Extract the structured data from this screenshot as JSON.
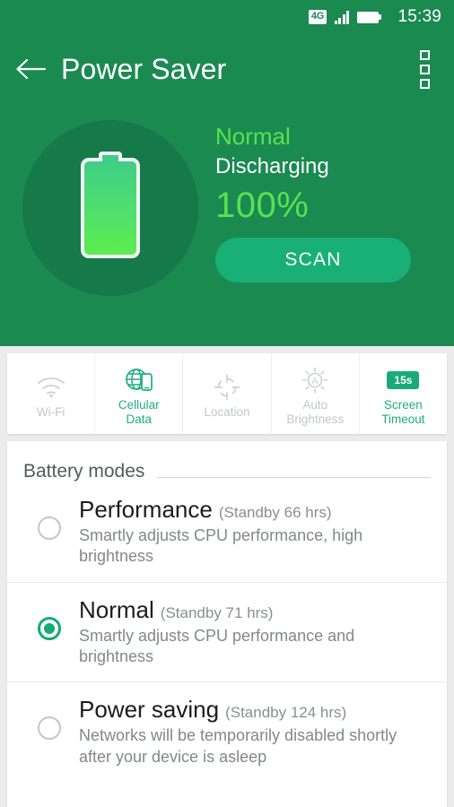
{
  "statusbar": {
    "network_badge": "4G",
    "time": "15:39",
    "signal_icon": "signal-bars-icon",
    "battery_icon": "battery-full-icon"
  },
  "appbar": {
    "title": "Power Saver",
    "back_icon": "back-arrow-icon",
    "overflow_icon": "overflow-menu-icon"
  },
  "hero": {
    "battery_icon": "battery-illustration-icon",
    "status": "Normal",
    "charging_state": "Discharging",
    "percent": "100%",
    "scan_label": "SCAN",
    "colors": {
      "header_bg": "#1a8a51",
      "circle_bg": "#16794a",
      "accent_green": "#57e251",
      "scan_bg": "#18b076"
    }
  },
  "toggles": [
    {
      "label": "Wi-Fi",
      "icon": "wifi-icon",
      "active": false,
      "badge": ""
    },
    {
      "label": "Cellular\nData",
      "label_line1": "Cellular",
      "label_line2": "Data",
      "icon": "cellular-data-icon",
      "active": true,
      "badge": ""
    },
    {
      "label": "Location",
      "icon": "location-crosshair-icon",
      "active": false,
      "badge": ""
    },
    {
      "label": "Auto\nBrightness",
      "label_line1": "Auto",
      "label_line2": "Brightness",
      "icon": "auto-brightness-icon",
      "active": false,
      "badge": ""
    },
    {
      "label": "Screen\nTimeout",
      "label_line1": "Screen",
      "label_line2": "Timeout",
      "icon": "screen-timeout-badge",
      "active": true,
      "badge": "15s"
    }
  ],
  "modes": {
    "header": "Battery modes",
    "items": [
      {
        "title": "Performance",
        "standby": "(Standby 66 hrs)",
        "description": "Smartly adjusts CPU performance, high brightness",
        "selected": false
      },
      {
        "title": "Normal",
        "standby": "(Standby 71 hrs)",
        "description": "Smartly adjusts CPU performance and brightness",
        "selected": true
      },
      {
        "title": "Power saving",
        "standby": "(Standby 124 hrs)",
        "description": "Networks will be temporarily disabled shortly after your device is asleep",
        "selected": false
      }
    ]
  }
}
